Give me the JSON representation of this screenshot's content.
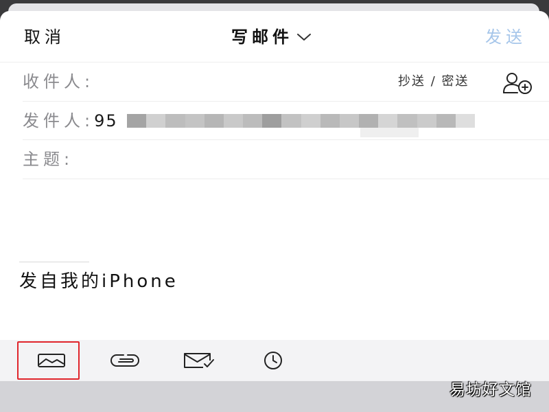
{
  "header": {
    "cancel": "取消",
    "title": "写邮件",
    "send": "发送"
  },
  "recipients": {
    "to_label": "收件人:",
    "cc_bcc": "抄送 / 密送"
  },
  "sender": {
    "label": "发件人:",
    "value_visible": "95"
  },
  "subject": {
    "label": "主题:"
  },
  "body": {
    "signature": "发自我的iPhone"
  },
  "toolbar": {
    "items": [
      {
        "icon": "image-icon",
        "highlighted": true
      },
      {
        "icon": "link-icon",
        "highlighted": false
      },
      {
        "icon": "mail-check-icon",
        "highlighted": false
      },
      {
        "icon": "clock-icon",
        "highlighted": false
      }
    ]
  },
  "watermark": "易坊好文馆",
  "colors": {
    "send": "#a6c6ea",
    "highlight": "#e0242b",
    "toolbar_bg": "#f3f3f5"
  }
}
